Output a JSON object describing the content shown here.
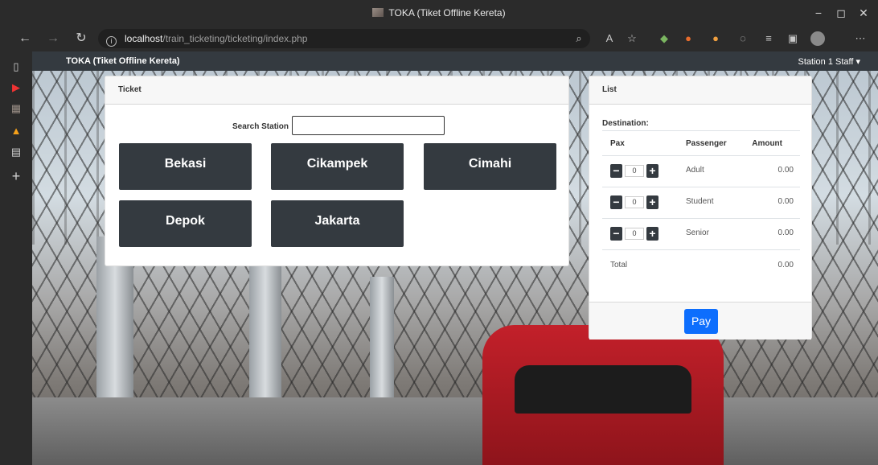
{
  "browser": {
    "window_title": "TOKA (Tiket Offline Kereta)",
    "url_host": "localhost",
    "url_path": "/train_ticketing/ticketing/index.php",
    "controls": {
      "minimize": "−",
      "restore": "◻",
      "close": "✕"
    }
  },
  "navbar": {
    "brand": "TOKA (Tiket Offline Kereta)",
    "user_menu": "Station 1 Staff ▾"
  },
  "ticket": {
    "header": "Ticket",
    "search_label": "Search Station",
    "search_value": "",
    "destinations": [
      "Bekasi",
      "Cikampek",
      "Cimahi",
      "Depok",
      "Jakarta"
    ]
  },
  "list": {
    "header": "List",
    "destination_label": "Destination:",
    "columns": {
      "pax": "Pax",
      "passenger": "Passenger",
      "amount": "Amount"
    },
    "rows": [
      {
        "pax": "0",
        "passenger": "Adult",
        "amount": "0.00"
      },
      {
        "pax": "0",
        "passenger": "Student",
        "amount": "0.00"
      },
      {
        "pax": "0",
        "passenger": "Senior",
        "amount": "0.00"
      }
    ],
    "total_label": "Total",
    "total_amount": "0.00",
    "pay_label": "Pay"
  },
  "colors": {
    "dark": "#343a40",
    "primary": "#0d6efd",
    "chrome": "#2b2b2b"
  }
}
